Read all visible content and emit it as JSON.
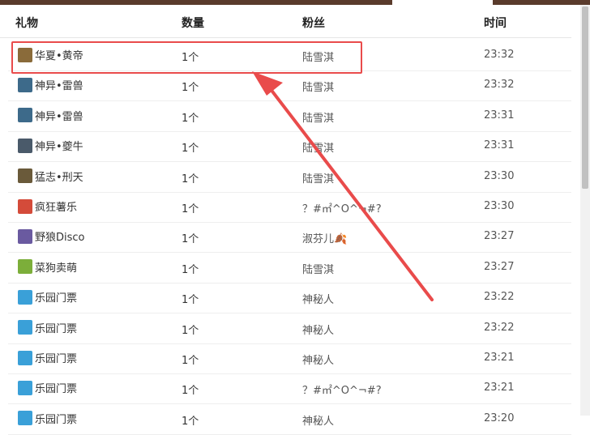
{
  "header": {
    "gift": "礼物",
    "quantity": "数量",
    "fans": "粉丝",
    "time": "时间"
  },
  "rows": [
    {
      "gift": "华夏•黄帝",
      "icon": "hero-icon",
      "icon_color": "#8a6b3a",
      "qty": "1个",
      "fan": "陆雪淇",
      "time": "23:32"
    },
    {
      "gift": "神异•雷兽",
      "icon": "thunder-beast-icon",
      "icon_color": "#3d6a8a",
      "qty": "1个",
      "fan": "陆雪淇",
      "time": "23:32"
    },
    {
      "gift": "神异•雷兽",
      "icon": "thunder-beast-icon",
      "icon_color": "#3d6a8a",
      "qty": "1个",
      "fan": "陆雪淇",
      "time": "23:31"
    },
    {
      "gift": "神异•夔牛",
      "icon": "kui-bull-icon",
      "icon_color": "#4a5a6a",
      "qty": "1个",
      "fan": "陆雪淇",
      "time": "23:31"
    },
    {
      "gift": "猛志•刑天",
      "icon": "xingtian-icon",
      "icon_color": "#6a5a3a",
      "qty": "1个",
      "fan": "陆雪淇",
      "time": "23:30"
    },
    {
      "gift": "疯狂薯乐",
      "icon": "car-icon",
      "icon_color": "#d44b3a",
      "qty": "1个",
      "fan": "？#㎡^O^¬#?",
      "time": "23:30"
    },
    {
      "gift": "野狼Disco",
      "icon": "wolf-icon",
      "icon_color": "#6a5aa0",
      "qty": "1个",
      "fan": "淑芬儿🍂",
      "time": "23:27"
    },
    {
      "gift": "菜狗卖萌",
      "icon": "dog-icon",
      "icon_color": "#7cae3a",
      "qty": "1个",
      "fan": "陆雪淇",
      "time": "23:27"
    },
    {
      "gift": "乐园门票",
      "icon": "ticket-icon",
      "icon_color": "#3aa0d8",
      "qty": "1个",
      "fan": "神秘人",
      "time": "23:22"
    },
    {
      "gift": "乐园门票",
      "icon": "ticket-icon",
      "icon_color": "#3aa0d8",
      "qty": "1个",
      "fan": "神秘人",
      "time": "23:22"
    },
    {
      "gift": "乐园门票",
      "icon": "ticket-icon",
      "icon_color": "#3aa0d8",
      "qty": "1个",
      "fan": "神秘人",
      "time": "23:21"
    },
    {
      "gift": "乐园门票",
      "icon": "ticket-icon",
      "icon_color": "#3aa0d8",
      "qty": "1个",
      "fan": "？#㎡^O^¬#?",
      "time": "23:21"
    },
    {
      "gift": "乐园门票",
      "icon": "ticket-icon",
      "icon_color": "#3aa0d8",
      "qty": "1个",
      "fan": "神秘人",
      "time": "23:20"
    }
  ],
  "colors": {
    "highlight": "#e94b4b",
    "arrow": "#e94b4b"
  }
}
